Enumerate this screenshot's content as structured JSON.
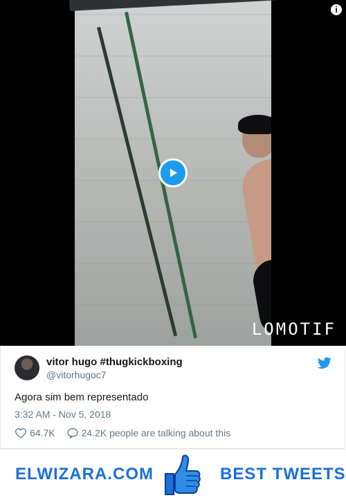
{
  "video": {
    "watermark": "LOMOTIF",
    "info_symbol": "i",
    "play_button": {
      "icon": "play-icon",
      "accent": "#1d9bf0"
    }
  },
  "tweet": {
    "author": {
      "name": "vitor hugo #thugkickboxing",
      "handle": "@vitorhugoc7",
      "avatar_icon": "avatar"
    },
    "text": "Agora sim bem representado",
    "timestamp": "3:32 AM - Nov 5, 2018",
    "likes": "64.7K",
    "talking": "24.2K people are talking about this",
    "icons": {
      "heart": "heart-icon",
      "comment": "comment-icon",
      "platform": "twitter-bird-icon"
    }
  },
  "banner": {
    "site": "ELWIZARA.COM",
    "tagline": "BEST TWEETS",
    "icon": "thumbs-up-icon",
    "brand_color": "#1b6fdc"
  },
  "colors": {
    "text_primary": "#14171a",
    "text_secondary": "#657786",
    "twitter_blue": "#1d9bf0",
    "brand_blue": "#1b6fdc"
  }
}
